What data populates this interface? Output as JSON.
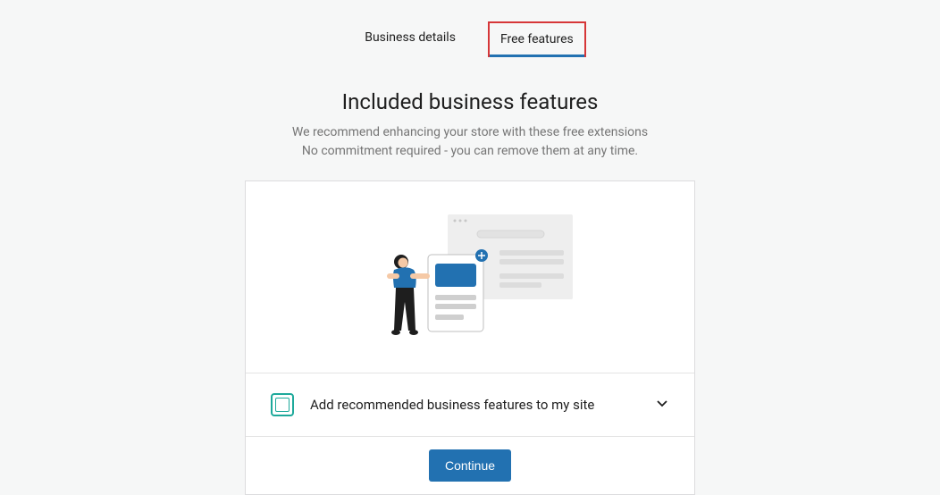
{
  "tabs": {
    "business_details": "Business details",
    "free_features": "Free features"
  },
  "headline": "Included business features",
  "subtext_line1": "We recommend enhancing your store with these free extensions",
  "subtext_line2": "No commitment required - you can remove them at any time.",
  "checkbox": {
    "label": "Add recommended business features to my site"
  },
  "footer": {
    "continue_label": "Continue"
  },
  "colors": {
    "primary": "#2271b1",
    "highlight_border": "#d63638",
    "teal": "#1ea99b"
  }
}
